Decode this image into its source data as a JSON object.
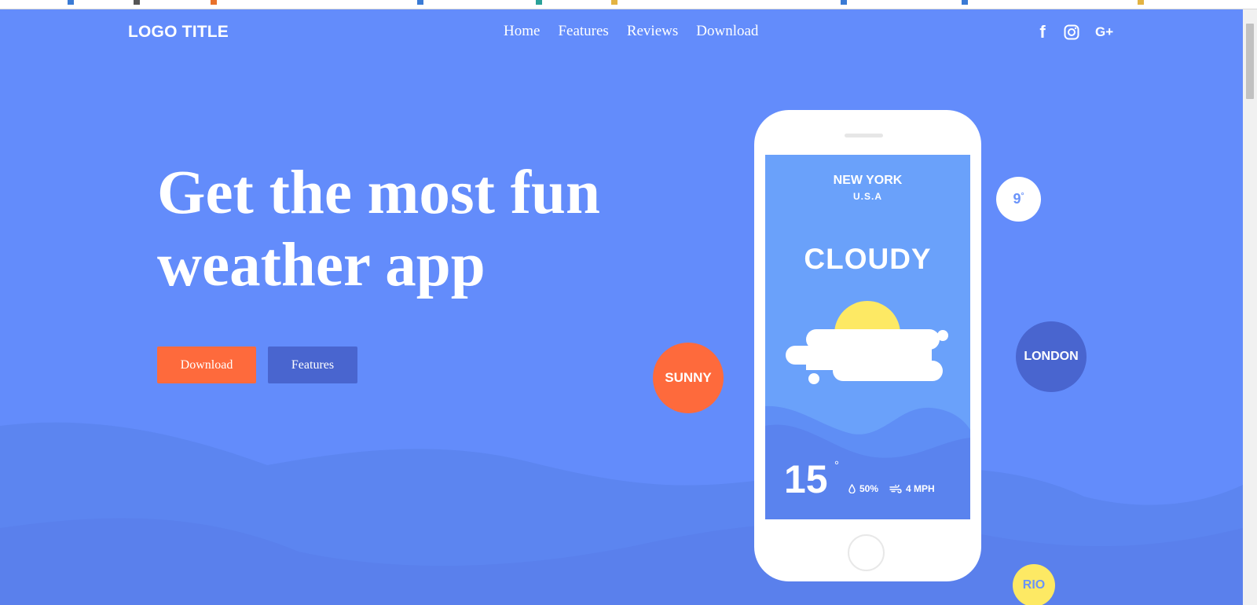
{
  "header": {
    "logo": "LOGO TITLE",
    "nav": [
      {
        "label": "Home"
      },
      {
        "label": "Features"
      },
      {
        "label": "Reviews"
      },
      {
        "label": "Download"
      }
    ],
    "social": {
      "facebook": "f",
      "instagram": "instagram-icon",
      "googleplus": "G+"
    }
  },
  "hero": {
    "headline_line1": "Get the most fun",
    "headline_line2": "weather app",
    "download_button": "Download",
    "features_button": "Features"
  },
  "phone": {
    "city": "NEW YORK",
    "country": "U.S.A",
    "condition": "CLOUDY",
    "temperature": "15",
    "degree_symbol": "°",
    "humidity": "50%",
    "wind": "4 MPH"
  },
  "bubbles": {
    "sunny": "SUNNY",
    "temp_value": "9",
    "temp_degree": "°",
    "london": "LONDON",
    "rio": "RIO"
  },
  "colors": {
    "background": "#638cfb",
    "accent_orange": "#fe6a3c",
    "accent_dark_blue": "#4965cf",
    "sun_yellow": "#fde964",
    "screen_blue": "#6aa1fa"
  }
}
